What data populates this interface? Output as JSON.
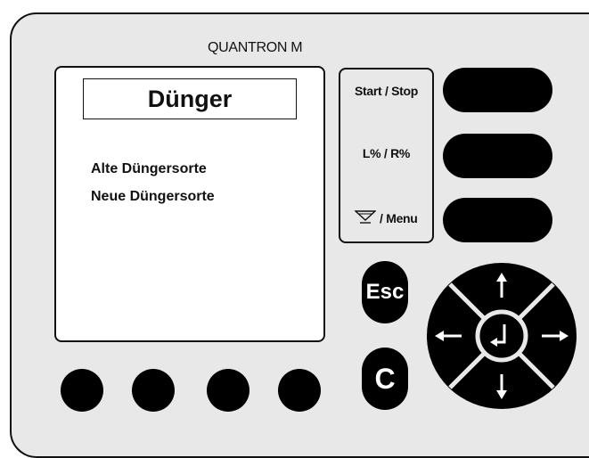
{
  "device": {
    "brand": "QUANTRON M"
  },
  "screen": {
    "title": "Dünger",
    "menu_items": [
      {
        "label": "Alte Düngersorte"
      },
      {
        "label": "Neue Düngersorte"
      }
    ]
  },
  "soft_labels": {
    "start_stop": "Start / Stop",
    "lr_percent": "L% / R%",
    "menu": "/ Menu"
  },
  "keys": {
    "esc": "Esc",
    "clear": "C"
  },
  "icons": {
    "menu_label_icon": "funnel-icon",
    "nav_up": "arrow-up-icon",
    "nav_down": "arrow-down-icon",
    "nav_left": "arrow-left-icon",
    "nav_right": "arrow-right-icon",
    "nav_center": "enter-icon"
  },
  "colors": {
    "panel": "#e8e8e8",
    "keys": "#000000",
    "screen": "#ffffff",
    "outline": "#111111"
  }
}
